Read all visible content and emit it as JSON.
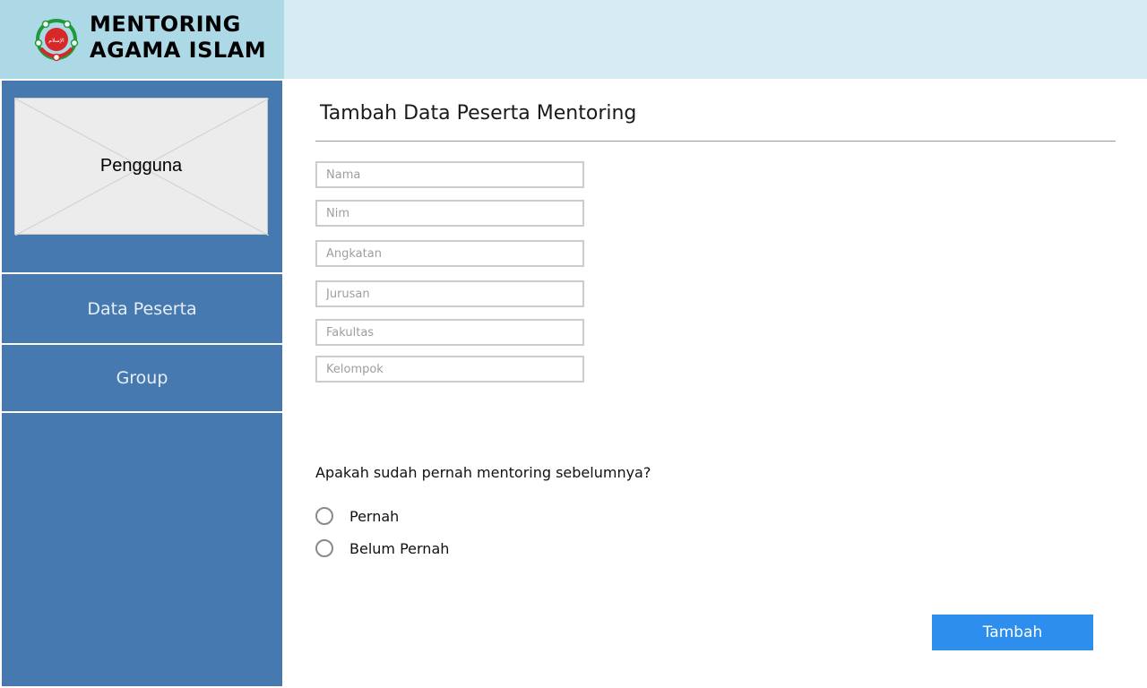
{
  "logo": {
    "line1": "MENTORING",
    "line2": "AGAMA ISLAM",
    "emblem_text": "الإسلام"
  },
  "sidebar": {
    "profile_label": "Pengguna",
    "items": [
      {
        "label": "Data Peserta"
      },
      {
        "label": "Group"
      }
    ]
  },
  "form": {
    "title": "Tambah Data Peserta Mentoring",
    "fields": [
      {
        "placeholder": "Nama",
        "value": ""
      },
      {
        "placeholder": "Nim",
        "value": ""
      },
      {
        "placeholder": "Angkatan",
        "value": ""
      },
      {
        "placeholder": "Jurusan",
        "value": ""
      },
      {
        "placeholder": "Fakultas",
        "value": ""
      },
      {
        "placeholder": "Kelompok",
        "value": ""
      }
    ],
    "question": "Apakah sudah pernah mentoring sebelumnya?",
    "options": [
      {
        "label": "Pernah"
      },
      {
        "label": "Belum Pernah"
      }
    ],
    "submit_label": "Tambah"
  },
  "colors": {
    "logo_bg": "#add8e6",
    "topbar_bg": "#d6ebf2",
    "sidebar_bg": "#4679b0",
    "button_bg": "#2d8eed"
  }
}
